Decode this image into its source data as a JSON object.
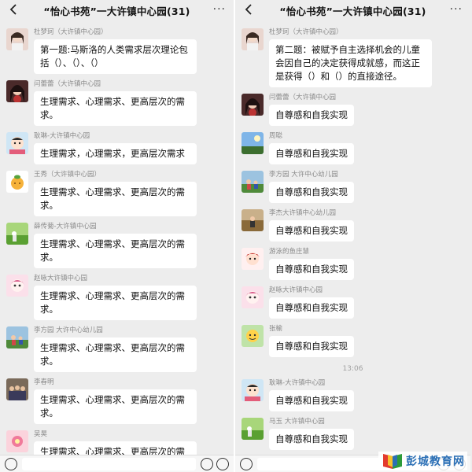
{
  "left": {
    "title": "“怡心书苑”一大许镇中心园(31)",
    "more_icon": "···",
    "messages": [
      {
        "sender": "杜梦珂（大许镇中心园）",
        "text": "第一题:马斯洛的人类需求层次理论包括（）、（）、（）",
        "avatar": "avatar-woman-photo"
      },
      {
        "sender": "闫蕾蕾（大许镇中心园",
        "text": "生理需求、心理需求、更高层次的需求。",
        "avatar": "avatar-dark-hair"
      },
      {
        "sender": "耿琳-大许镇中心园",
        "text": "生理需求，心理需求，更高层次需求",
        "avatar": "avatar-cartoon-girl"
      },
      {
        "sender": "王秀（大许镇中心园）",
        "text": "生理需求、心理需求、更高层次的需求。",
        "avatar": "avatar-fruit"
      },
      {
        "sender": "薛传菊-大许镇中心园",
        "text": "生理需求、心理需求、更高层次的需求。",
        "avatar": "avatar-green-field"
      },
      {
        "sender": "赵咏大许镇中心园",
        "text": "生理需求、心理需求、更高层次的需求。",
        "avatar": "avatar-pink-cartoon"
      },
      {
        "sender": "李方园 大许中心幼儿园",
        "text": "生理需求、心理需求、更高层次的需求。",
        "avatar": "avatar-photo-people"
      },
      {
        "sender": "李春明",
        "text": "生理需求、心理需求、更高层次的需求。",
        "avatar": "avatar-group-photo"
      },
      {
        "sender": "吴昊",
        "text": "生理需求、心理需求、更高层次的需",
        "avatar": "avatar-pink-flower"
      }
    ]
  },
  "right": {
    "title": "“怡心书苑”一大许镇中心园(31)",
    "more_icon": "···",
    "messages": [
      {
        "sender": "杜梦珂（大许镇中心园）",
        "text": "第二题：被赋予自主选择机会的儿童会因自己的决定获得成就感，而这正是获得（）和（）的直接途径。",
        "avatar": "avatar-woman-photo"
      },
      {
        "sender": "闫蕾蕾（大许镇中心园",
        "text": "自尊感和自我实现",
        "avatar": "avatar-dark-hair"
      },
      {
        "sender": "周聪",
        "text": "自尊感和自我实现",
        "avatar": "avatar-sky"
      },
      {
        "sender": "李方园 大许中心幼儿园",
        "text": "自尊感和自我实现",
        "avatar": "avatar-photo-people"
      },
      {
        "sender": "李杰大许镇中心幼儿园",
        "text": "自尊感和自我实现",
        "avatar": "avatar-outdoor"
      },
      {
        "sender": "游泳的鱼庄慧",
        "text": "自尊感和自我实现",
        "avatar": "avatar-red-cartoon"
      },
      {
        "sender": "赵咏大许镇中心园",
        "text": "自尊感和自我实现",
        "avatar": "avatar-pink-cartoon"
      },
      {
        "sender": "张榆",
        "text": "自尊感和自我实现",
        "avatar": "avatar-yellow-cartoon"
      }
    ],
    "timestamp": "13:06",
    "messages_after": [
      {
        "sender": "耿琳-大许镇中心园",
        "text": "自尊感和自我实现",
        "avatar": "avatar-cartoon-girl"
      },
      {
        "sender": "马玉 大许镇中心园",
        "text": "自尊感和自我实现",
        "avatar": "avatar-green-field"
      }
    ]
  },
  "watermark": {
    "text": "彭城教育网",
    "logo_icon": "book-logo-icon"
  },
  "colors": {
    "background": "#ededed",
    "bubble": "#ffffff",
    "sender": "#8a8a8a",
    "watermark": "#2b6fb5"
  }
}
